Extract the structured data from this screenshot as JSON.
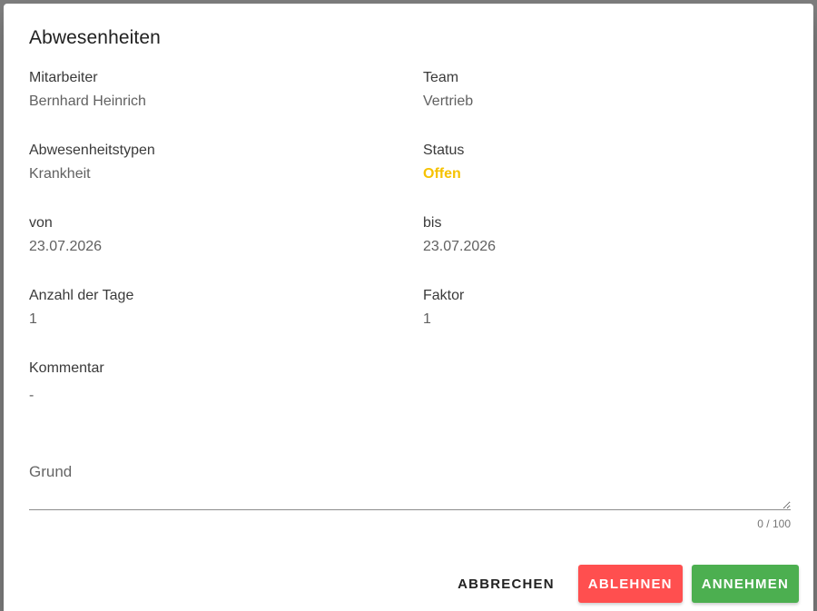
{
  "dialog": {
    "title": "Abwesenheiten"
  },
  "fields": {
    "employee": {
      "label": "Mitarbeiter",
      "value": "Bernhard Heinrich"
    },
    "team": {
      "label": "Team",
      "value": "Vertrieb"
    },
    "absence_type": {
      "label": "Abwesenheitstypen",
      "value": "Krankheit"
    },
    "status": {
      "label": "Status",
      "value": "Offen",
      "color": "#f6c200"
    },
    "from": {
      "label": "von",
      "value": "23.07.2026"
    },
    "to": {
      "label": "bis",
      "value": "23.07.2026"
    },
    "days": {
      "label": "Anzahl der Tage",
      "value": "1"
    },
    "factor": {
      "label": "Faktor",
      "value": "1"
    },
    "comment": {
      "label": "Kommentar",
      "value": "-"
    }
  },
  "reason": {
    "placeholder": "Grund",
    "value": "",
    "counter": "0 / 100"
  },
  "actions": {
    "cancel_label": "ABBRECHEN",
    "reject_label": "ABLEHNEN",
    "accept_label": "ANNEHMEN",
    "reject_color": "#ff4f4f",
    "accept_color": "#4caf50"
  }
}
